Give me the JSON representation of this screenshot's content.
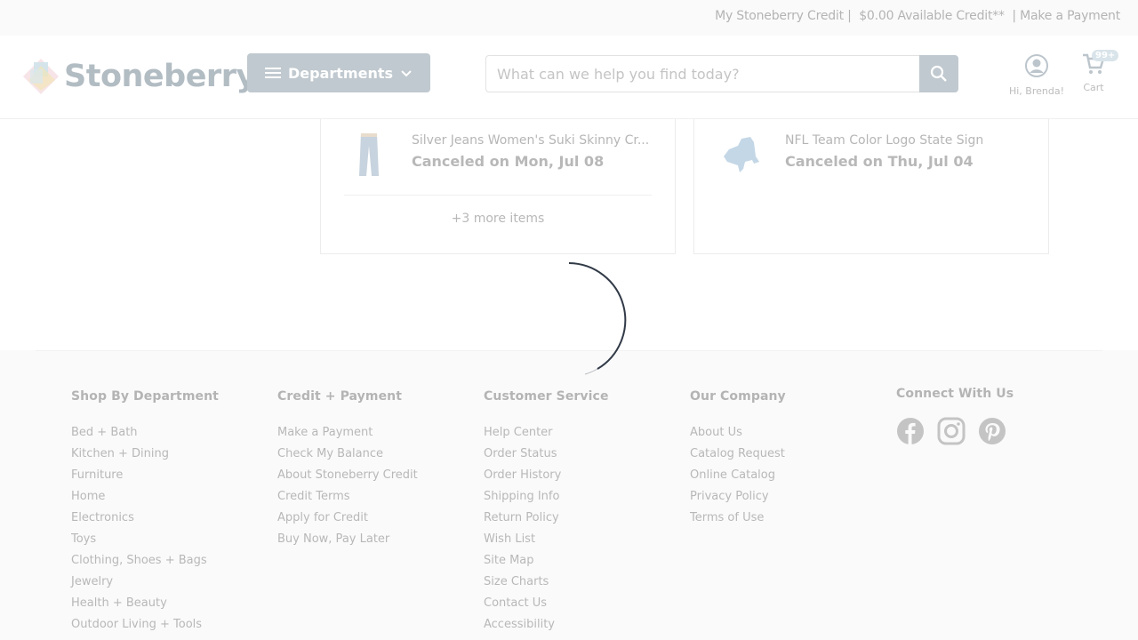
{
  "utility_bar": {
    "credit_link": "My Stoneberry Credit |",
    "available_credit": "$0.00 Available Credit**",
    "make_payment": "| Make a Payment"
  },
  "header": {
    "logo_text": "Stoneberry",
    "departments_label": "Departments",
    "search_placeholder": "What can we help you find today?",
    "account_label": "Hi, Brenda!",
    "cart_label": "Cart",
    "cart_badge": "99+"
  },
  "orders": {
    "left_card": {
      "item_name": "Silver Jeans Women's Suki Skinny Cr...",
      "item_status": "Canceled on Mon, Jul 08",
      "more_items": "+3 more items"
    },
    "right_card": {
      "item_name": "NFL Team Color Logo State Sign",
      "item_status": "Canceled on Thu, Jul 04"
    }
  },
  "footer": {
    "shop_by_department": {
      "heading": "Shop By Department",
      "links": [
        "Bed + Bath",
        "Kitchen + Dining",
        "Furniture",
        "Home",
        "Electronics",
        "Toys",
        "Clothing, Shoes + Bags",
        "Jewelry",
        "Health + Beauty",
        "Outdoor Living + Tools"
      ]
    },
    "credit_payment": {
      "heading": "Credit + Payment",
      "links": [
        "Make a Payment",
        "Check My Balance",
        "About Stoneberry Credit",
        "Credit Terms",
        "Apply for Credit",
        "Buy Now, Pay Later"
      ]
    },
    "customer_service": {
      "heading": "Customer Service",
      "links": [
        "Help Center",
        "Order Status",
        "Order History",
        "Shipping Info",
        "Return Policy",
        "Wish List",
        "Site Map",
        "Size Charts",
        "Contact Us",
        "Accessibility"
      ]
    },
    "our_company": {
      "heading": "Our Company",
      "links": [
        "About Us",
        "Catalog Request",
        "Online Catalog",
        "Privacy Policy",
        "Terms of Use"
      ]
    },
    "connect": {
      "heading": "Connect With Us",
      "icons": [
        "facebook-icon",
        "instagram-icon",
        "pinterest-icon"
      ]
    }
  },
  "colors": {
    "button_bg": "#c0c9cf",
    "footer_bg": "#fafafa",
    "spinner": "#1b2533"
  }
}
